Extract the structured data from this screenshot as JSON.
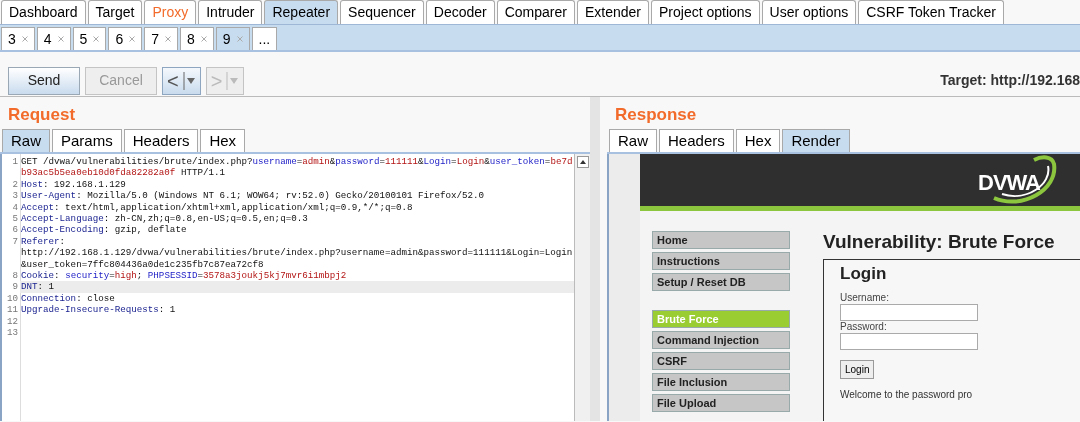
{
  "top_tabs": [
    {
      "label": "Dashboard",
      "selected": false,
      "highlighted": false
    },
    {
      "label": "Target",
      "selected": false,
      "highlighted": false
    },
    {
      "label": "Proxy",
      "selected": false,
      "highlighted": true
    },
    {
      "label": "Intruder",
      "selected": false,
      "highlighted": false
    },
    {
      "label": "Repeater",
      "selected": true,
      "highlighted": false
    },
    {
      "label": "Sequencer",
      "selected": false,
      "highlighted": false
    },
    {
      "label": "Decoder",
      "selected": false,
      "highlighted": false
    },
    {
      "label": "Comparer",
      "selected": false,
      "highlighted": false
    },
    {
      "label": "Extender",
      "selected": false,
      "highlighted": false
    },
    {
      "label": "Project options",
      "selected": false,
      "highlighted": false
    },
    {
      "label": "User options",
      "selected": false,
      "highlighted": false
    },
    {
      "label": "CSRF Token Tracker",
      "selected": false,
      "highlighted": false
    }
  ],
  "sub_tabs": [
    {
      "label": "3",
      "selected": false,
      "closable": true
    },
    {
      "label": "4",
      "selected": false,
      "closable": true
    },
    {
      "label": "5",
      "selected": false,
      "closable": true
    },
    {
      "label": "6",
      "selected": false,
      "closable": true
    },
    {
      "label": "7",
      "selected": false,
      "closable": true
    },
    {
      "label": "8",
      "selected": false,
      "closable": true
    },
    {
      "label": "9",
      "selected": true,
      "closable": true
    },
    {
      "label": "...",
      "selected": false,
      "closable": false
    }
  ],
  "toolbar": {
    "buttons": [
      {
        "kind": "text",
        "label": "Send",
        "disabled": false
      },
      {
        "kind": "text",
        "label": "Cancel",
        "disabled": true
      },
      {
        "kind": "nav",
        "label": "<",
        "disabled": false
      },
      {
        "kind": "nav",
        "label": ">",
        "disabled": true
      }
    ],
    "target": "Target: http://192.168"
  },
  "request": {
    "title": "Request",
    "tabs": [
      {
        "label": "Raw",
        "selected": true
      },
      {
        "label": "Params",
        "selected": false
      },
      {
        "label": "Headers",
        "selected": false
      },
      {
        "label": "Hex",
        "selected": false
      }
    ],
    "lines": [
      {
        "number": "1",
        "highlighted": false,
        "segments": [
          {
            "kind": "plain",
            "text": "GET /dvwa/vulnerabilities/brute/index.php?"
          },
          {
            "kind": "param",
            "text": "username"
          },
          {
            "kind": "plain",
            "text": "="
          },
          {
            "kind": "value",
            "text": "admin"
          },
          {
            "kind": "plain",
            "text": "&"
          },
          {
            "kind": "param",
            "text": "password"
          },
          {
            "kind": "plain",
            "text": "="
          },
          {
            "kind": "value",
            "text": "111111"
          },
          {
            "kind": "plain",
            "text": "&"
          },
          {
            "kind": "param",
            "text": "Login"
          },
          {
            "kind": "plain",
            "text": "="
          },
          {
            "kind": "value",
            "text": "Login"
          },
          {
            "kind": "plain",
            "text": "&"
          },
          {
            "kind": "param",
            "text": "user_token"
          },
          {
            "kind": "plain",
            "text": "="
          },
          {
            "kind": "value",
            "text": "be7db93ac5b5ea0eb10d0fda82282a0f"
          },
          {
            "kind": "plain",
            "text": " HTTP/1.1"
          }
        ]
      },
      {
        "number": "2",
        "highlighted": false,
        "segments": [
          {
            "kind": "header",
            "text": "Host"
          },
          {
            "kind": "plain",
            "text": ": 192.168.1.129"
          }
        ]
      },
      {
        "number": "3",
        "highlighted": false,
        "segments": [
          {
            "kind": "header",
            "text": "User-Agent"
          },
          {
            "kind": "plain",
            "text": ": Mozilla/5.0 (Windows NT 6.1; WOW64; rv:52.0) Gecko/20100101 Firefox/52.0"
          }
        ]
      },
      {
        "number": "4",
        "highlighted": false,
        "segments": [
          {
            "kind": "header",
            "text": "Accept"
          },
          {
            "kind": "plain",
            "text": ": text/html,application/xhtml+xml,application/xml;q=0.9,*/*;q=0.8"
          }
        ]
      },
      {
        "number": "5",
        "highlighted": false,
        "segments": [
          {
            "kind": "header",
            "text": "Accept-Language"
          },
          {
            "kind": "plain",
            "text": ": zh-CN,zh;q=0.8,en-US;q=0.5,en;q=0.3"
          }
        ]
      },
      {
        "number": "6",
        "highlighted": false,
        "segments": [
          {
            "kind": "header",
            "text": "Accept-Encoding"
          },
          {
            "kind": "plain",
            "text": ": gzip, deflate"
          }
        ]
      },
      {
        "number": "7",
        "highlighted": false,
        "segments": [
          {
            "kind": "header",
            "text": "Referer"
          },
          {
            "kind": "plain",
            "text": ":"
          },
          {
            "kind": "break",
            "text": "http://192.168.1.129/dvwa/vulnerabilities/brute/index.php?username=admin&password=111111&Login=Login&user_token=7ffc804436a0de1c235fb7c87ea72cf8"
          }
        ]
      },
      {
        "number": "8",
        "highlighted": false,
        "segments": [
          {
            "kind": "header",
            "text": "Cookie"
          },
          {
            "kind": "plain",
            "text": ": "
          },
          {
            "kind": "param",
            "text": "security"
          },
          {
            "kind": "plain",
            "text": "="
          },
          {
            "kind": "value",
            "text": "high"
          },
          {
            "kind": "plain",
            "text": "; "
          },
          {
            "kind": "param",
            "text": "PHPSESSID"
          },
          {
            "kind": "plain",
            "text": "="
          },
          {
            "kind": "value",
            "text": "3578a3joukj5kj7mvr6i1mbpj2"
          }
        ]
      },
      {
        "number": "9",
        "highlighted": true,
        "segments": [
          {
            "kind": "header",
            "text": "DNT"
          },
          {
            "kind": "plain",
            "text": ": 1"
          }
        ]
      },
      {
        "number": "10",
        "highlighted": false,
        "segments": [
          {
            "kind": "header",
            "text": "Connection"
          },
          {
            "kind": "plain",
            "text": ": close"
          }
        ]
      },
      {
        "number": "11",
        "highlighted": false,
        "segments": [
          {
            "kind": "header",
            "text": "Upgrade-Insecure-Requests"
          },
          {
            "kind": "plain",
            "text": ": 1"
          }
        ]
      },
      {
        "number": "12",
        "highlighted": false
      },
      {
        "number": "13",
        "highlighted": false
      }
    ]
  },
  "response": {
    "title": "Response",
    "tabs": [
      {
        "label": "Raw",
        "selected": false
      },
      {
        "label": "Headers",
        "selected": false
      },
      {
        "label": "Hex",
        "selected": false
      },
      {
        "label": "Render",
        "selected": true
      }
    ],
    "render": {
      "logo": "DVWA",
      "menu_groups": [
        [
          {
            "label": "Home",
            "selected": false
          },
          {
            "label": "Instructions",
            "selected": false
          },
          {
            "label": "Setup / Reset DB",
            "selected": false
          }
        ],
        [
          {
            "label": "Brute Force",
            "selected": true
          },
          {
            "label": "Command Injection",
            "selected": false
          },
          {
            "label": "CSRF",
            "selected": false
          },
          {
            "label": "File Inclusion",
            "selected": false
          },
          {
            "label": "File Upload",
            "selected": false
          }
        ]
      ],
      "heading": "Vulnerability: Brute Force",
      "login": {
        "title": "Login",
        "fields": [
          {
            "label": "Username:"
          },
          {
            "label": "Password:"
          }
        ],
        "button": "Login",
        "welcome": "Welcome to the password pro"
      }
    }
  }
}
